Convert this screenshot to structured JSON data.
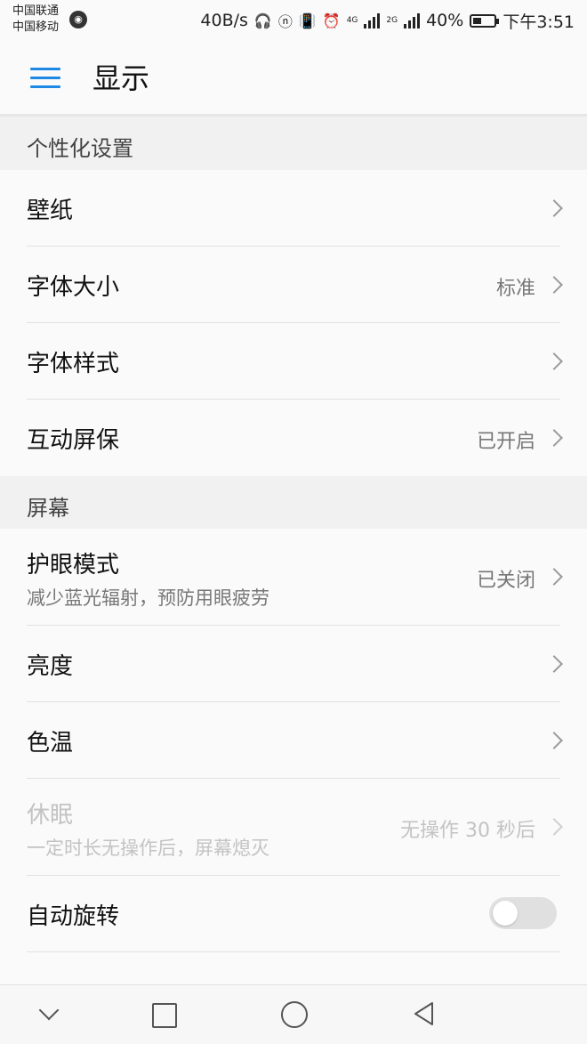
{
  "status_bar": {
    "carrier1": "中国联通",
    "carrier2": "中国移动",
    "speed": "40B/s",
    "net1": "4G",
    "net2": "2G",
    "battery": "40%",
    "battery_level": 0.4,
    "time": "下午3:51"
  },
  "header": {
    "title": "显示"
  },
  "sections": {
    "personal": {
      "label": "个性化设置"
    },
    "screen": {
      "label": "屏幕"
    }
  },
  "rows": {
    "wallpaper": {
      "title": "壁纸"
    },
    "font_size": {
      "title": "字体大小",
      "value": "标准"
    },
    "font_style": {
      "title": "字体样式"
    },
    "screensaver": {
      "title": "互动屏保",
      "value": "已开启"
    },
    "eye_comfort": {
      "title": "护眼模式",
      "subtitle": "减少蓝光辐射，预防用眼疲劳",
      "value": "已关闭"
    },
    "brightness": {
      "title": "亮度"
    },
    "color_temp": {
      "title": "色温"
    },
    "sleep": {
      "title": "休眠",
      "subtitle": "一定时长无操作后，屏幕熄灭",
      "value": "无操作 30 秒后"
    },
    "auto_rotate": {
      "title": "自动旋转",
      "enabled": false
    }
  },
  "colors": {
    "accent": "#1e88e5"
  }
}
